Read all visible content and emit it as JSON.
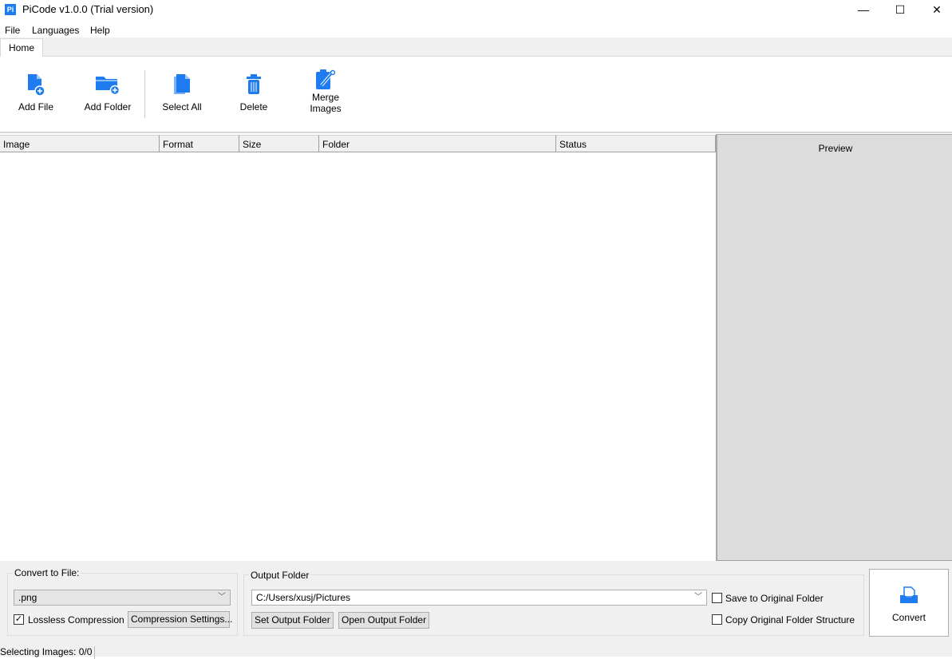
{
  "window": {
    "title": "PiCode v1.0.0 (Trial version)",
    "logo": "Pi",
    "minimize": "—",
    "maximize": "☐",
    "close": "✕"
  },
  "menu": [
    "File",
    "Languages",
    "Help"
  ],
  "tabs": [
    {
      "label": "Home",
      "active": true
    }
  ],
  "toolbar": {
    "add_file": "Add File",
    "add_folder": "Add Folder",
    "select_all": "Select All",
    "delete": "Delete",
    "merge_line1": "Merge",
    "merge_line2": "Images"
  },
  "table": {
    "columns": [
      "Image",
      "Format",
      "Size",
      "Folder",
      "Status"
    ],
    "rows": []
  },
  "preview": {
    "label": "Preview"
  },
  "convert_group": {
    "label": "Convert to File:",
    "format": ".png",
    "lossless_label": "Lossless Compression",
    "lossless_checked": true,
    "settings_button": "Compression Settings..."
  },
  "output_group": {
    "label": "Output Folder",
    "path": "C:/Users/xusj/Pictures",
    "set_button": "Set Output Folder",
    "open_button": "Open Output Folder",
    "save_original_label": "Save to Original Folder",
    "save_original_checked": false,
    "copy_structure_label": "Copy Original Folder Structure",
    "copy_structure_checked": false
  },
  "convert_button": "Convert",
  "status": "Selecting Images: 0/0",
  "colors": {
    "accent": "#1e7cf0"
  }
}
